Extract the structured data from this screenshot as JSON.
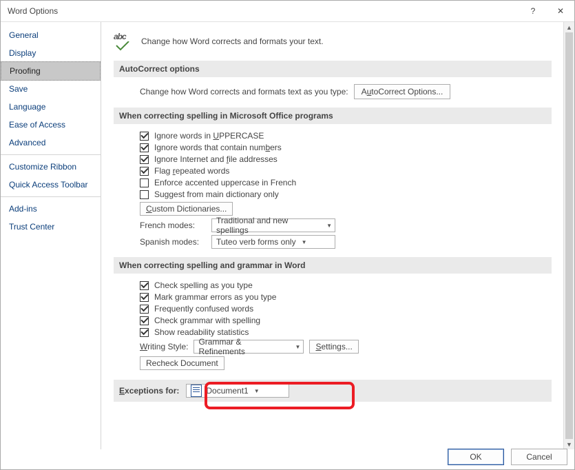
{
  "window": {
    "title": "Word Options",
    "help": "?",
    "close": "✕"
  },
  "sidebar": {
    "items": [
      "General",
      "Display",
      "Proofing",
      "Save",
      "Language",
      "Ease of Access",
      "Advanced",
      "Customize Ribbon",
      "Quick Access Toolbar",
      "Add-ins",
      "Trust Center"
    ],
    "selectedIndex": 2
  },
  "intro": {
    "abc": "abc",
    "text": "Change how Word corrects and formats your text."
  },
  "sections": {
    "s1": {
      "title": "AutoCorrect options",
      "desc": "Change how Word corrects and formats text as you type:",
      "btn": {
        "pre": "A",
        "u": "u",
        "post": "toCorrect Options..."
      }
    },
    "s2": {
      "title": "When correcting spelling in Microsoft Office programs",
      "checks": [
        {
          "checked": true,
          "pre": "Ignore words in ",
          "u": "U",
          "post": "PPERCASE"
        },
        {
          "checked": true,
          "pre": "Ignore words that contain num",
          "u": "b",
          "post": "ers"
        },
        {
          "checked": true,
          "pre": "Ignore Internet and ",
          "u": "f",
          "post": "ile addresses"
        },
        {
          "checked": true,
          "pre": "Flag ",
          "u": "r",
          "post": "epeated words"
        },
        {
          "checked": false,
          "pre": "Enforce accented uppercase in French",
          "u": "",
          "post": ""
        },
        {
          "checked": false,
          "pre": "Suggest from main dictionary only",
          "u": "",
          "post": ""
        }
      ],
      "customBtn": {
        "u": "C",
        "post": "ustom Dictionaries..."
      },
      "french": {
        "label": "French modes:",
        "value": "Traditional and new spellings"
      },
      "spanish": {
        "label": "Spanish modes:",
        "value": "Tuteo verb forms only"
      }
    },
    "s3": {
      "title": "When correcting spelling and grammar in Word",
      "checks": [
        {
          "checked": true,
          "text": "Check spelling as you type"
        },
        {
          "checked": true,
          "text": "Mark grammar errors as you type"
        },
        {
          "checked": true,
          "text": "Frequently confused words"
        },
        {
          "checked": true,
          "text": "Check grammar with spelling"
        },
        {
          "checked": true,
          "text": "Show readability statistics"
        }
      ],
      "ws": {
        "label_u": "W",
        "label_post": "riting Style:",
        "value": "Grammar & Refinements",
        "settings_u": "S",
        "settings_post": "ettings..."
      },
      "recheck": "Recheck Document"
    },
    "exc": {
      "label_u": "E",
      "label_pre": "",
      "label_post": "xceptions for:",
      "value": "Document1"
    }
  },
  "footer": {
    "ok": "OK",
    "cancel": "Cancel"
  }
}
